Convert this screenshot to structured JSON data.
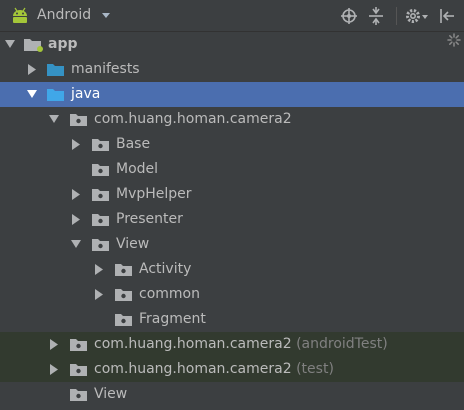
{
  "toolbar": {
    "title": "Android",
    "icons": [
      "android-icon",
      "dropdown-arrow-icon",
      "locate-icon",
      "collapse-all-icon",
      "settings-icon",
      "hide-panel-icon"
    ]
  },
  "tree": {
    "app": "app",
    "manifests": "manifests",
    "java": "java",
    "pkg_main": "com.huang.homan.camera2",
    "base": "Base",
    "model": "Model",
    "mvphelper": "MvpHelper",
    "presenter": "Presenter",
    "view": "View",
    "activity": "Activity",
    "common": "common",
    "fragment": "Fragment",
    "pkg_android_test": "com.huang.homan.camera2",
    "pkg_android_test_suffix": "(androidTest)",
    "pkg_test": "com.huang.homan.camera2",
    "pkg_test_suffix": "(test)",
    "view_bottom": "View"
  },
  "colors": {
    "background": "#3c3f41",
    "selection": "#4b6eaf",
    "text": "#bbbbbb",
    "folder_blue": "#3592c4",
    "folder_gray": "#afb1b3",
    "android_green": "#a4c639",
    "tint_row": "#323a2f"
  }
}
